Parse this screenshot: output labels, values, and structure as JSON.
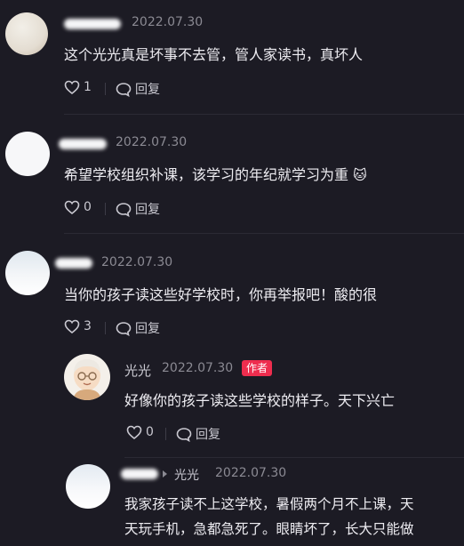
{
  "comments": [
    {
      "date": "2022.07.30",
      "text": "这个光光真是坏事不去管，管人家读书，真坏人",
      "likes": "1",
      "reply_label": "回复"
    },
    {
      "date": "2022.07.30",
      "text": "希望学校组织补课，该学习的年纪就学习为重",
      "emoji": "🐱",
      "likes": "0",
      "reply_label": "回复"
    },
    {
      "date": "2022.07.30",
      "text": "当你的孩子读这些好学校时，你再举报吧！酸的很",
      "likes": "3",
      "reply_label": "回复"
    }
  ],
  "author_reply": {
    "name": "光光",
    "date": "2022.07.30",
    "badge": "作者",
    "text": "好像你的孩子读这些学校的样子。天下兴亡",
    "likes": "0",
    "reply_label": "回复"
  },
  "nested_reply": {
    "reply_to": "光光",
    "date": "2022.07.30",
    "text_line1": "我家孩子读不上这学校，暑假两个月不上课，天",
    "text_line2": "天玩手机，急都急死了。眼睛坏了，长大只能做"
  },
  "colors": {
    "background": "#1c1b24",
    "badge": "#ee2d4e",
    "meta_text": "#8b8a93"
  },
  "icons": [
    "heart-icon",
    "comment-bubble-icon",
    "reply-arrow-icon"
  ]
}
